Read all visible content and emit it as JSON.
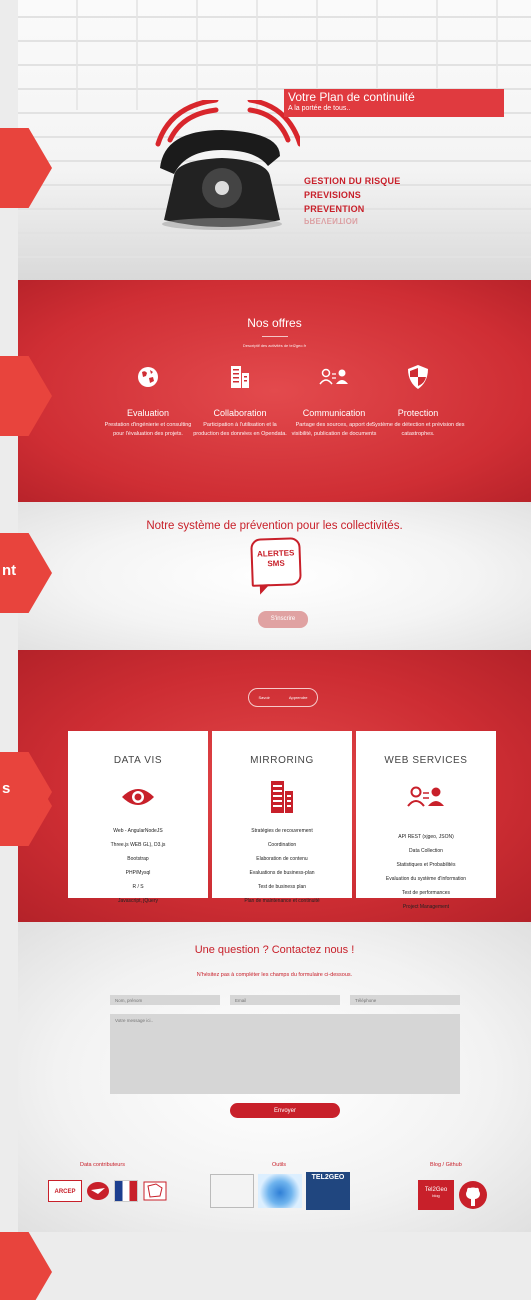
{
  "hero": {
    "banner_title": "Votre Plan de continuité",
    "banner_subtitle": "A la portée de tous..",
    "list": [
      "GESTION  DU  RISQUE",
      "PREVISIONS",
      "PREVENTION"
    ],
    "list_reflection": "PREVENTION"
  },
  "side_labels": {
    "label_3": "nt",
    "label_5": "s"
  },
  "offres": {
    "title": "Nos offres",
    "subtitle": "Descriptif des activités de tel2geo.fr",
    "items": [
      {
        "title": "Evaluation",
        "desc": "Prestation d'ingénierie et consulting pour l'évaluation des projets."
      },
      {
        "title": "Collaboration",
        "desc": "Participation à l'utilisation et la production des données en Opendata."
      },
      {
        "title": "Communication",
        "desc": "Partage des sources, apport de visibilité, publication de documents"
      },
      {
        "title": "Protection",
        "desc": "Système de détection et prévision des catastrophes."
      }
    ]
  },
  "prevention": {
    "title": "Notre système de prévention pour les collectivités.",
    "badge_line1": "ALERTES",
    "badge_line2": "SMS",
    "button": "S'inscrire"
  },
  "services": {
    "toggle": [
      "Savoir",
      "Apprendre"
    ],
    "cards": [
      {
        "title": "DATA VIS",
        "items": [
          "Web - AngularNodeJS",
          "Three.js WEB GL), D3.js",
          "Bootstrap",
          "PHP/Mysql",
          "R / S",
          "Javascript, jQuery"
        ]
      },
      {
        "title": "MIRRORING",
        "items": [
          "Stratégies de recouvrement",
          "Coordination",
          "Elaboration de contenu",
          "Evaluations de business-plan",
          "Test de business plan",
          "Plan de maintenance et continuité"
        ]
      },
      {
        "title": "WEB SERVICES",
        "items": [
          "API REST (xjgeo, JSON)",
          "Data Collection",
          "Statistiques et Probabilités",
          "Evaluation du système d'information",
          "Test de performances",
          "Project Management"
        ]
      }
    ]
  },
  "contact": {
    "title": "Une question ? Contactez nous !",
    "intro": "N'hésitez pas à compléter les champs du formulaire ci-dessous.",
    "name_placeholder": "Nom, prénom",
    "email_placeholder": "Email",
    "phone_placeholder": "Téléphone",
    "message_placeholder": "Votre message ici..",
    "send": "Envoyer"
  },
  "footer": {
    "col1": "Data contributeurs",
    "col2": "Outils",
    "col3": "Blog / Github",
    "logo_arcep": "ARCEP",
    "logo_tel2geo": "TEL2GEO",
    "logo_tel2geo_blog": "Tel2Geo",
    "logo_blog_sub": "blog"
  },
  "colors": {
    "accent": "#c8202a",
    "accent_bright": "#e8443d"
  }
}
